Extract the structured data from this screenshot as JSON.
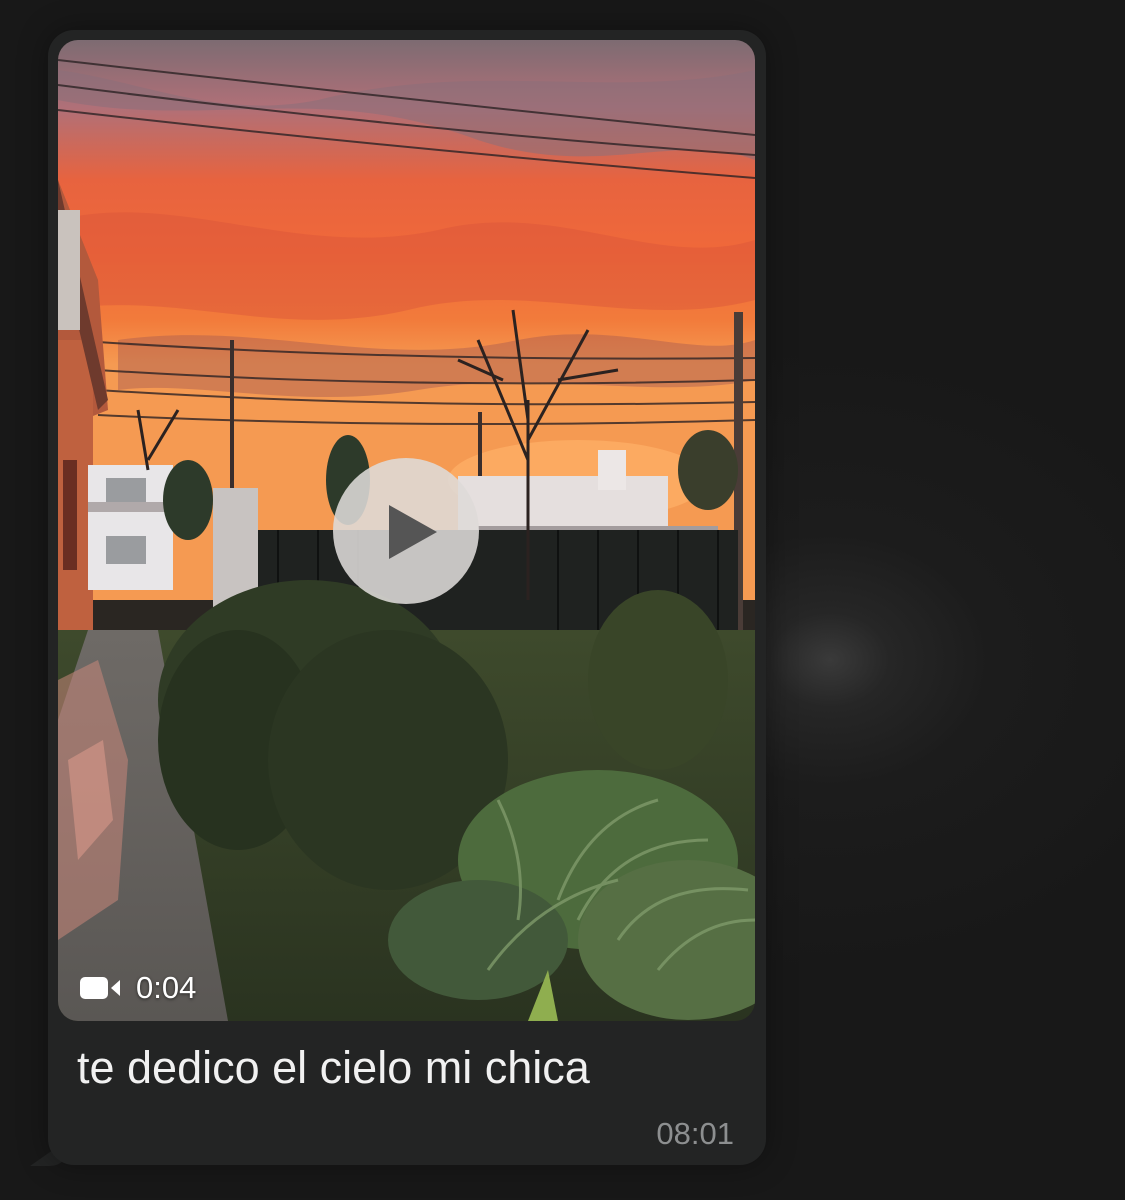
{
  "message": {
    "media_type": "video",
    "duration": "0:04",
    "duration_icon": "video-camera-icon",
    "play_icon": "play-icon",
    "caption": "te dedico el cielo mi chica",
    "time": "08:01"
  },
  "colors": {
    "chat_background": "#1a1a1a",
    "bubble_background": "#232424",
    "caption_text": "#f1f1f1",
    "timestamp_text": "#8d8f90",
    "play_button": "#dedbd8"
  }
}
